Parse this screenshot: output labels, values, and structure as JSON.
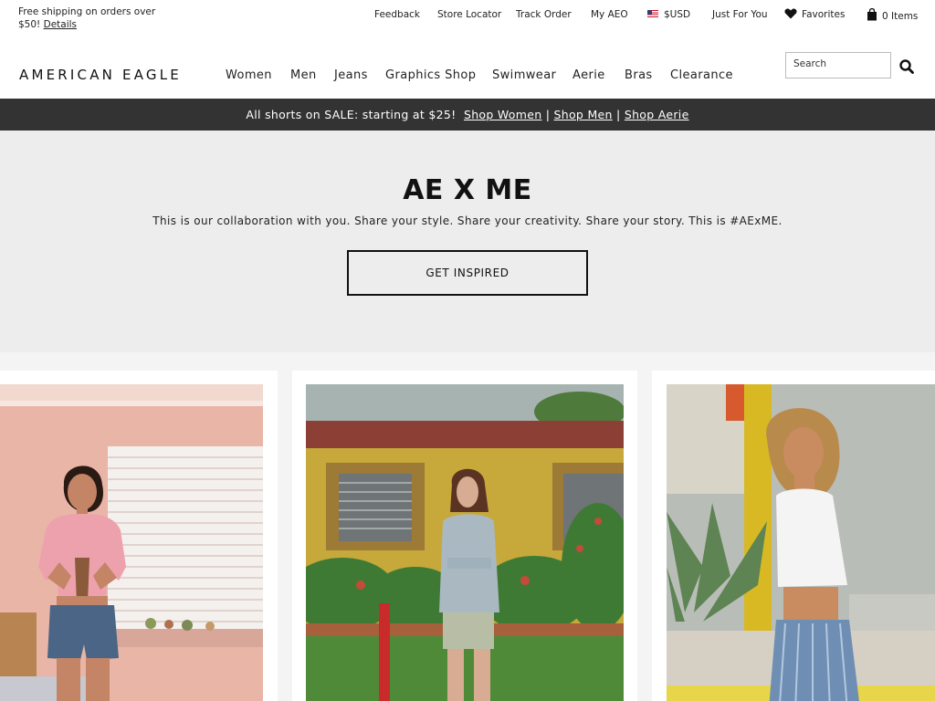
{
  "topbar": {
    "shipping_text": "Free shipping on orders over $50!",
    "details_link": "Details",
    "links": [
      "Feedback",
      "Store Locator",
      "Track Order",
      "My AEO"
    ],
    "currency": "$USD",
    "just_for_you": "Just For You",
    "favorites": "Favorites",
    "bag_count": "0 Items"
  },
  "brand": {
    "logo_text": "AMERICAN EAGLE"
  },
  "nav": {
    "items": [
      "Women",
      "Men",
      "Jeans",
      "Graphics Shop",
      "Swimwear",
      "Aerie",
      "Bras",
      "Clearance"
    ]
  },
  "search": {
    "placeholder": "Search"
  },
  "promo": {
    "text": "All shorts on SALE: starting at $25!",
    "links": [
      "Shop Women",
      "Shop Men",
      "Shop Aerie"
    ],
    "separator": "|"
  },
  "hero": {
    "title": "AE X ME",
    "subtitle": "This is our collaboration with you. Share your style. Share your creativity. Share your story. This is #AExME.",
    "button": "GET INSPIRED"
  },
  "colors": {
    "promo_bg": "#333333",
    "hero_bg": "#ededed",
    "gallery_bg": "#f4f4f4"
  }
}
